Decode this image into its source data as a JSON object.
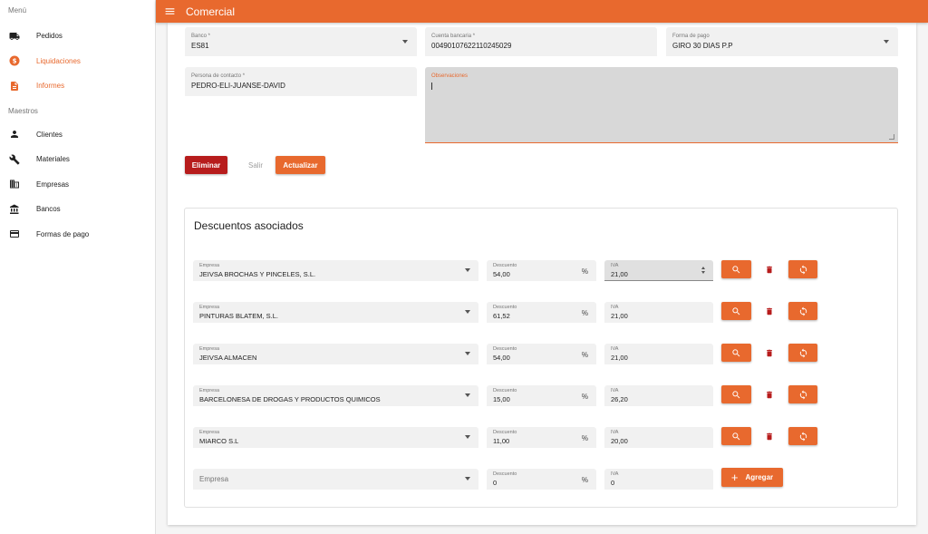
{
  "sidebar": {
    "menu_label": "Menú",
    "menu_items": [
      {
        "label": "Pedidos",
        "icon": "truck-icon"
      },
      {
        "label": "Liquidaciones",
        "icon": "dollar-icon",
        "active": true
      },
      {
        "label": "Informes",
        "icon": "document-icon",
        "active": true
      }
    ],
    "masters_label": "Maestros",
    "master_items": [
      {
        "label": "Clientes",
        "icon": "person-icon"
      },
      {
        "label": "Materiales",
        "icon": "tools-icon"
      },
      {
        "label": "Empresas",
        "icon": "building-icon"
      },
      {
        "label": "Bancos",
        "icon": "bank-icon"
      },
      {
        "label": "Formas de pago",
        "icon": "credit-card-icon"
      }
    ]
  },
  "header": {
    "title": "Comercial",
    "menu_icon": "hamburger-icon"
  },
  "form": {
    "banco": {
      "label": "Banco *",
      "value": "ES81"
    },
    "cuenta": {
      "label": "Cuenta bancaria *",
      "value": "00490107622110245029"
    },
    "forma_pago": {
      "label": "Forma de pago",
      "value": "GIRO 30 DIAS P.P"
    },
    "contacto": {
      "label": "Persona de contacto *",
      "value": "PEDRO-ELI-JUANSE-DAVID"
    },
    "observaciones": {
      "label": "Observaciones",
      "value": ""
    }
  },
  "actions": {
    "eliminar": "Eliminar",
    "salir": "Salir",
    "actualizar": "Actualizar"
  },
  "descuentos": {
    "title": "Descuentos asociados",
    "empresa_label": "Empresa",
    "descuento_label": "Descuento",
    "iva_label": "IVA",
    "percent_symbol": "%",
    "rows": [
      {
        "empresa": "JEIVSA BROCHAS Y PINCELES, S.L.",
        "descuento": "54,00",
        "iva": "21,00"
      },
      {
        "empresa": "PINTURAS BLATEM, S.L.",
        "descuento": "61,52",
        "iva": "21,00"
      },
      {
        "empresa": "JEIVSA ALMACEN",
        "descuento": "54,00",
        "iva": "21,00"
      },
      {
        "empresa": "BARCELONESA DE DROGAS Y PRODUCTOS QUIMICOS",
        "descuento": "15,00",
        "iva": "26,20"
      },
      {
        "empresa": "MIARCO S.L",
        "descuento": "11,00",
        "iva": "20,00"
      }
    ],
    "new_row": {
      "empresa_placeholder": "Empresa",
      "descuento": "0",
      "iva": "0",
      "add_label": "Agregar"
    }
  },
  "colors": {
    "accent": "#e8692e",
    "danger": "#b71c1c"
  }
}
